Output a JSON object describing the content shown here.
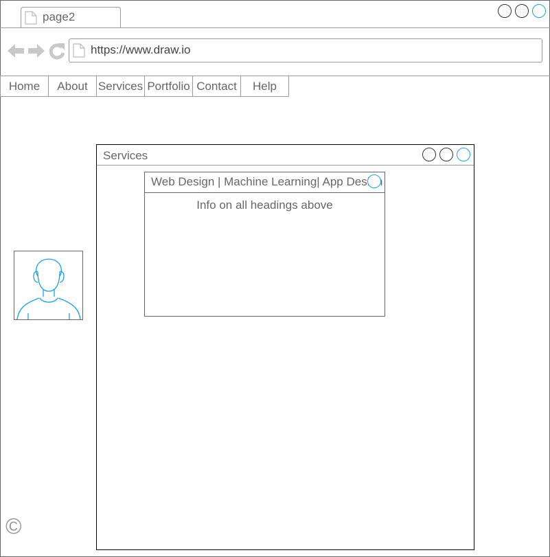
{
  "browser": {
    "tab_label": "page2",
    "url": "https://www.draw.io",
    "icons": [
      "page-icon",
      "back-arrow-icon",
      "forward-arrow-icon",
      "reload-icon"
    ]
  },
  "nav": {
    "items": [
      {
        "label": "Home"
      },
      {
        "label": "About"
      },
      {
        "label": "Services"
      },
      {
        "label": "Portfolio"
      },
      {
        "label": "Contact"
      },
      {
        "label": "Help"
      }
    ]
  },
  "services_window": {
    "title": "Services"
  },
  "services_card": {
    "heading": "Web Design | Machine Learning| App Design",
    "body": "Info on all headings above"
  },
  "footer": {
    "copyright_symbol": "©"
  },
  "colors": {
    "accent": "#1ba1e2",
    "border": "#999999",
    "text": "#666666"
  }
}
